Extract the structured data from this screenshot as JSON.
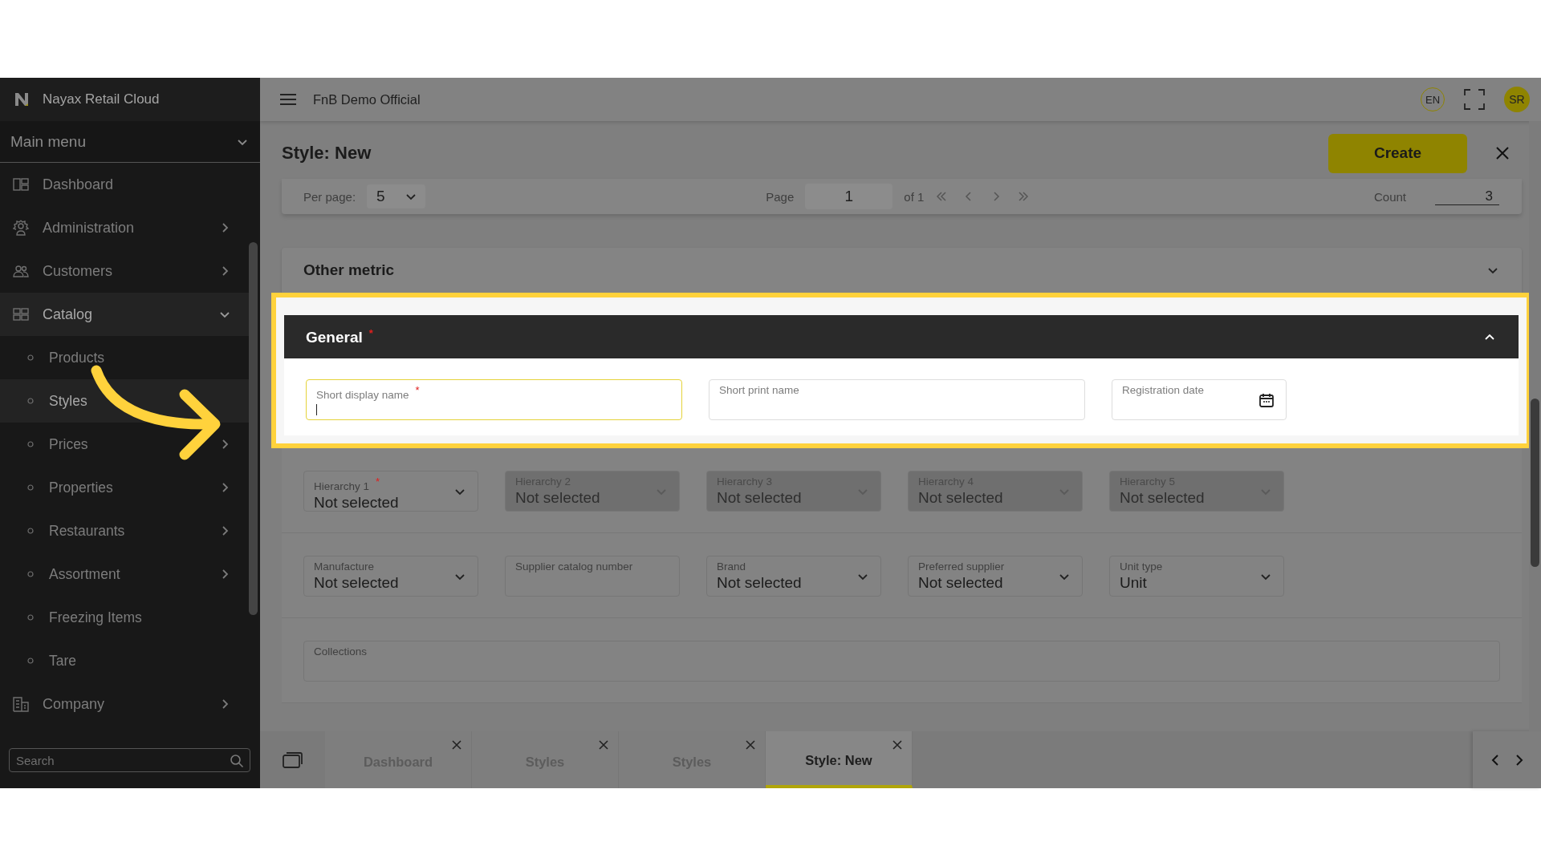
{
  "sidebar": {
    "brand": "Nayax Retail Cloud",
    "main_menu": "Main menu",
    "items": [
      {
        "label": "Dashboard",
        "has_submenu": false,
        "selected": false
      },
      {
        "label": "Administration",
        "has_submenu": true,
        "expanded": false,
        "selected": false
      },
      {
        "label": "Customers",
        "has_submenu": true,
        "expanded": false,
        "selected": false
      },
      {
        "label": "Catalog",
        "has_submenu": true,
        "expanded": true,
        "selected": true,
        "children": [
          {
            "label": "Products",
            "has_submenu": false,
            "selected": false
          },
          {
            "label": "Styles",
            "has_submenu": false,
            "selected": true
          },
          {
            "label": "Prices",
            "has_submenu": true,
            "selected": false
          },
          {
            "label": "Properties",
            "has_submenu": true,
            "selected": false
          },
          {
            "label": "Restaurants",
            "has_submenu": true,
            "selected": false
          },
          {
            "label": "Assortment",
            "has_submenu": true,
            "selected": false
          },
          {
            "label": "Freezing Items",
            "has_submenu": false,
            "selected": false
          },
          {
            "label": "Tare",
            "has_submenu": false,
            "selected": false
          }
        ]
      },
      {
        "label": "Company",
        "has_submenu": true,
        "expanded": false,
        "selected": false
      }
    ],
    "search": {
      "placeholder": "Search"
    }
  },
  "header": {
    "title": "FnB Demo Official",
    "language": "EN",
    "avatar": "SR"
  },
  "page": {
    "title": "Style: New",
    "create_button": "Create"
  },
  "pagination": {
    "per_page_label": "Per page:",
    "per_page": "5",
    "page_label": "Page",
    "page": "1",
    "of": "of 1",
    "count_label": "Count",
    "count": "3"
  },
  "sections": [
    {
      "title": "Other metric",
      "expanded": false
    },
    {
      "title": "General",
      "required_mark": "*",
      "expanded": true,
      "highlighted": true,
      "fields": [
        {
          "kind": "text",
          "label": "Short display name",
          "required_mark": "*",
          "focused": true
        },
        {
          "kind": "text",
          "label": "Short print name",
          "focused": false
        },
        {
          "kind": "date",
          "label": "Registration date",
          "focused": false
        }
      ]
    }
  ],
  "field_rows": [
    [
      {
        "kind": "select",
        "label": "Hierarchy 1",
        "required_mark": "*",
        "value": "Not selected",
        "disabled": false
      },
      {
        "kind": "select",
        "label": "Hierarchy 2",
        "value": "Not selected",
        "disabled": true
      },
      {
        "kind": "select",
        "label": "Hierarchy 3",
        "value": "Not selected",
        "disabled": true
      },
      {
        "kind": "select",
        "label": "Hierarchy 4",
        "value": "Not selected",
        "disabled": true
      },
      {
        "kind": "select",
        "label": "Hierarchy 5",
        "value": "Not selected",
        "disabled": true
      }
    ],
    [
      {
        "kind": "select",
        "label": "Manufacture",
        "value": "Not selected",
        "disabled": false
      },
      {
        "kind": "text",
        "label": "Supplier catalog number",
        "disabled": false
      },
      {
        "kind": "select",
        "label": "Brand",
        "value": "Not selected",
        "disabled": false
      },
      {
        "kind": "select",
        "label": "Preferred supplier",
        "value": "Not selected",
        "disabled": false
      },
      {
        "kind": "select",
        "label": "Unit type",
        "value": "Unit",
        "disabled": false
      }
    ],
    [
      {
        "kind": "wide",
        "label": "Collections",
        "disabled": false
      }
    ]
  ],
  "bottom_tabs": [
    {
      "label": "Dashboard",
      "selected": false
    },
    {
      "label": "Styles",
      "selected": false
    },
    {
      "label": "Styles",
      "selected": false
    },
    {
      "label": "Style: New",
      "selected": true
    }
  ]
}
